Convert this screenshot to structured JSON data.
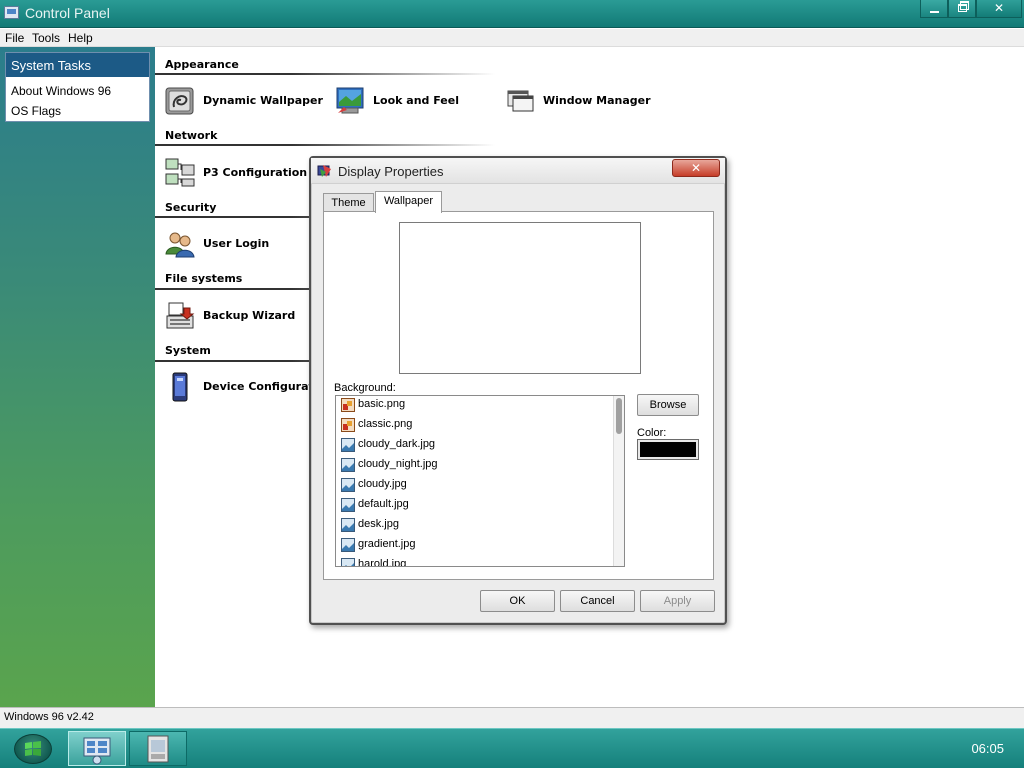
{
  "window": {
    "title": "Control Panel",
    "minimize_icon": "minimize-icon",
    "maximize_icon": "restore-icon",
    "close_icon": "close-icon"
  },
  "menu": [
    "File",
    "Tools",
    "Help"
  ],
  "sidebar": {
    "tasks_title": "System Tasks",
    "tasks": [
      "About Windows 96",
      "OS Flags"
    ]
  },
  "categories": [
    {
      "name": "Appearance",
      "applets": [
        {
          "label": "Dynamic Wallpaper",
          "icon": "dynamic-wallpaper-icon"
        },
        {
          "label": "Look and Feel",
          "icon": "look-and-feel-icon"
        },
        {
          "label": "Window Manager",
          "icon": "window-manager-icon"
        }
      ]
    },
    {
      "name": "Network",
      "applets": [
        {
          "label": "P3 Configuration",
          "icon": "network-computers-icon"
        }
      ]
    },
    {
      "name": "Security",
      "applets": [
        {
          "label": "User Login",
          "icon": "users-icon"
        }
      ]
    },
    {
      "name": "File systems",
      "applets": [
        {
          "label": "Backup Wizard",
          "icon": "backup-icon"
        }
      ]
    },
    {
      "name": "System",
      "applets": [
        {
          "label": "Device Configuratio",
          "icon": "device-icon"
        }
      ]
    }
  ],
  "dialog": {
    "title": "Display Properties",
    "close_icon": "close-icon",
    "tabs": [
      {
        "label": "Theme",
        "active": false
      },
      {
        "label": "Wallpaper",
        "active": true
      }
    ],
    "background_label": "Background:",
    "files": [
      {
        "name": "basic.png",
        "type": "png"
      },
      {
        "name": "classic.png",
        "type": "png"
      },
      {
        "name": "cloudy_dark.jpg",
        "type": "jpg"
      },
      {
        "name": "cloudy_night.jpg",
        "type": "jpg"
      },
      {
        "name": "cloudy.jpg",
        "type": "jpg"
      },
      {
        "name": "default.jpg",
        "type": "jpg"
      },
      {
        "name": "desk.jpg",
        "type": "jpg"
      },
      {
        "name": "gradient.jpg",
        "type": "jpg"
      },
      {
        "name": "harold.jpg",
        "type": "jpg"
      }
    ],
    "browse_label": "Browse",
    "color_label": "Color:",
    "color_value": "#000000",
    "ok_label": "OK",
    "cancel_label": "Cancel",
    "apply_label": "Apply"
  },
  "status_text": "Windows 96 v2.42",
  "taskbar": {
    "start_icon": "start-logo-icon",
    "items": [
      {
        "icon": "control-panel-icon",
        "active": true
      },
      {
        "icon": "display-properties-icon",
        "active": false
      }
    ],
    "clock": "06:05"
  },
  "colors": {
    "titlebar": "#127a76",
    "sidebar_header": "#1c5a86",
    "close_button": "#c63d28",
    "taskbar": "#15807b"
  }
}
